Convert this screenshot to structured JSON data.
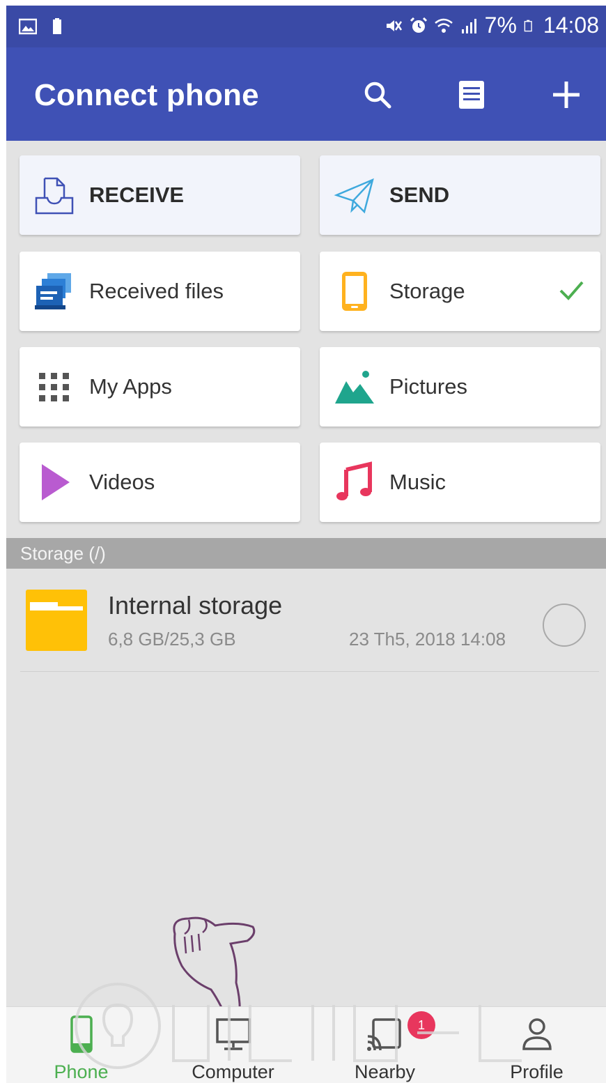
{
  "status_bar": {
    "battery": "7%",
    "time": "14:08"
  },
  "app_bar": {
    "title": "Connect phone"
  },
  "grid": {
    "receive": "RECEIVE",
    "send": "SEND",
    "received_files": "Received files",
    "storage": "Storage",
    "my_apps": "My Apps",
    "pictures": "Pictures",
    "videos": "Videos",
    "music": "Music"
  },
  "section": {
    "header": "Storage (/)"
  },
  "storage_item": {
    "name": "Internal storage",
    "size": "6,8 GB/25,3 GB",
    "date": "23 Th5, 2018 14:08"
  },
  "bottom_nav": {
    "phone": "Phone",
    "computer": "Computer",
    "nearby": "Nearby",
    "nearby_badge": "1",
    "profile": "Profile"
  },
  "colors": {
    "primary": "#3f51b5",
    "status_bar": "#3a4aa6",
    "active_nav": "#4caf50",
    "folder": "#ffc107",
    "badge": "#e8365d"
  }
}
